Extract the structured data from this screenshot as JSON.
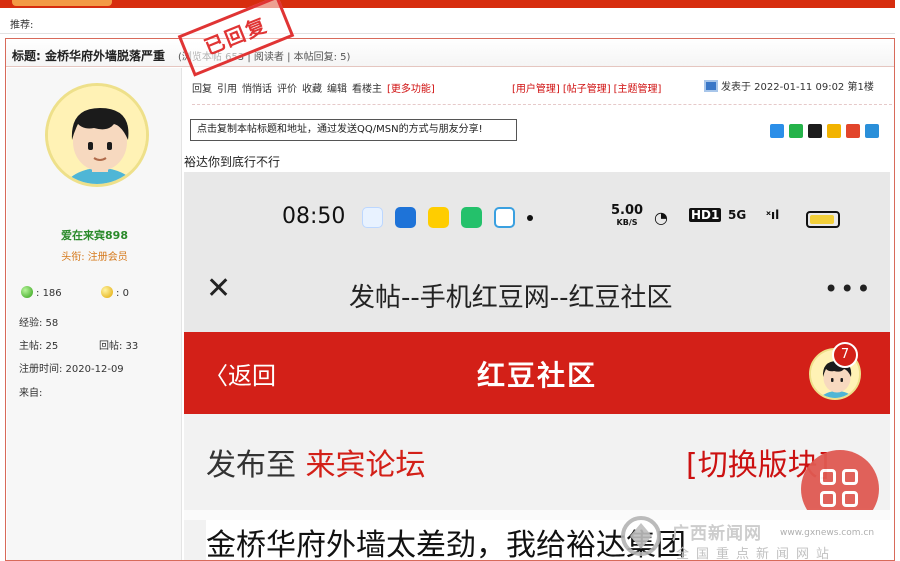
{
  "top": {
    "recommend_label": "推荐:"
  },
  "post": {
    "title": "标题: 金桥华府外墙脱落严重",
    "meta": "(浏览本帖 653 | 阅读者 | 本帖回复: 5)",
    "stamp": "已回复"
  },
  "author": {
    "name": "爱在来宾898",
    "title": "头衔: 注册会员",
    "green_count": "186",
    "yellow_count": "0",
    "exp": "经验: 58",
    "posts": "主帖: 25",
    "replies": "回帖: 33",
    "registered": "注册时间: 2020-12-09",
    "from": "来自:"
  },
  "toolbar": {
    "items": [
      "回复",
      "引用",
      "悄悄话",
      "评价",
      "收藏",
      "编辑",
      "看楼主"
    ],
    "more": "[更多功能]",
    "manage": [
      "[用户管理]",
      "[帖子管理]",
      "[主题管理]"
    ],
    "posted": "发表于 2022-01-11 09:02 第1楼"
  },
  "share": {
    "text": "点击复制本帖标题和地址，通过发送QQ/MSN的方式与朋友分享!"
  },
  "body": {
    "text": "裕达你到底行不行"
  },
  "phone": {
    "time": "08:50",
    "net_speed": "5.00",
    "net_unit": "KB/S",
    "hd": "HD1",
    "signal": "5G",
    "nav_close": "✕",
    "nav_title": "发帖--手机红豆网--红豆社区",
    "nav_more": "•••",
    "back": "〈返回",
    "red_title": "红豆社区",
    "badge": "7",
    "publish_label": "发布至",
    "forum": "来宾论坛",
    "switch": "[切换版块]",
    "draft": "金桥华府外墙太差劲，我给裕达集团"
  },
  "watermark": {
    "name": "广西新闻网",
    "url": "www.gxnews.com.cn",
    "slogan": "全国重点新闻网站"
  },
  "colors": {
    "topbar": "#d72d0e",
    "red": "#d32018",
    "green_text": "#2a8a2a",
    "orange_text": "#d5781a"
  }
}
